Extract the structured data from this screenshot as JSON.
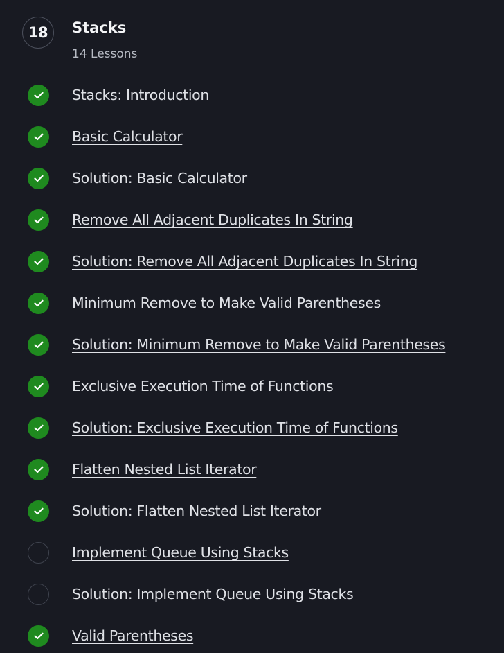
{
  "module": {
    "number": "18",
    "title": "Stacks",
    "lesson_count": "14 Lessons"
  },
  "lessons": [
    {
      "label": "Stacks: Introduction",
      "completed": true
    },
    {
      "label": "Basic Calculator",
      "completed": true
    },
    {
      "label": "Solution: Basic Calculator",
      "completed": true
    },
    {
      "label": "Remove All Adjacent Duplicates In String",
      "completed": true
    },
    {
      "label": "Solution: Remove All Adjacent Duplicates In String",
      "completed": true
    },
    {
      "label": "Minimum Remove to Make Valid Parentheses",
      "completed": true
    },
    {
      "label": "Solution: Minimum Remove to Make Valid Parentheses",
      "completed": true
    },
    {
      "label": "Exclusive Execution Time of Functions",
      "completed": true
    },
    {
      "label": "Solution: Exclusive Execution Time of Functions",
      "completed": true
    },
    {
      "label": "Flatten Nested List Iterator",
      "completed": true
    },
    {
      "label": "Solution: Flatten Nested List Iterator",
      "completed": true
    },
    {
      "label": "Implement Queue Using Stacks",
      "completed": false
    },
    {
      "label": "Solution: Implement Queue Using Stacks",
      "completed": false
    },
    {
      "label": "Valid Parentheses",
      "completed": true
    }
  ],
  "colors": {
    "background": "#181a22",
    "completed": "#1f8a1f",
    "link_text": "#dfe1e6"
  },
  "icons": {
    "completed": "check-circle-icon",
    "incomplete": "empty-circle-icon"
  }
}
